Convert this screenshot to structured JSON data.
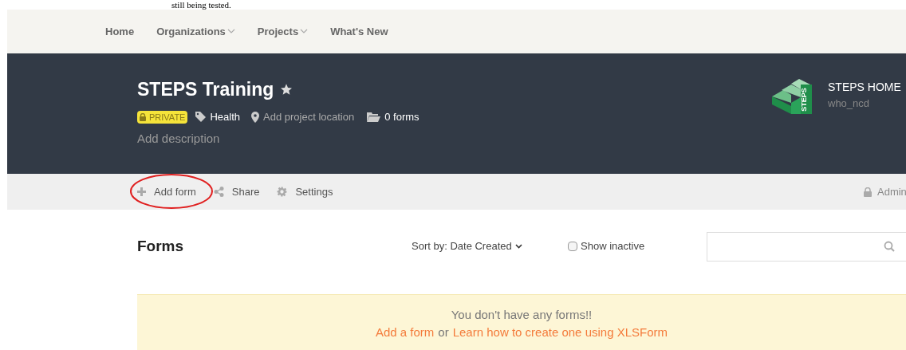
{
  "document_text": "still being tested.",
  "nav": [
    {
      "label": "Home",
      "dropdown": false
    },
    {
      "label": "Organizations",
      "dropdown": true
    },
    {
      "label": "Projects",
      "dropdown": true
    },
    {
      "label": "What's New",
      "dropdown": false
    }
  ],
  "project": {
    "title": "STEPS Training",
    "starred": true,
    "privacy": "PRIVATE",
    "tag": "Health",
    "location": "Add project location",
    "forms_count": "0 forms",
    "description": "Add description"
  },
  "owner": {
    "name": "STEPS HOME",
    "username": "who_ncd",
    "logo_text": "STEPS"
  },
  "actions": [
    {
      "label": "Add form",
      "circled": true
    },
    {
      "label": "Share",
      "circled": false
    },
    {
      "label": "Settings",
      "circled": false
    }
  ],
  "admin_label": "Admin",
  "forms": {
    "heading": "Forms",
    "sort_label": "Sort by: Date Created",
    "show_inactive": {
      "label": "Show inactive",
      "checked": false
    }
  },
  "empty": {
    "message": "You don't have any forms!!",
    "link_1": "Add a form",
    "joiner": "or",
    "link_2": "Learn how to create one using XLSForm"
  }
}
